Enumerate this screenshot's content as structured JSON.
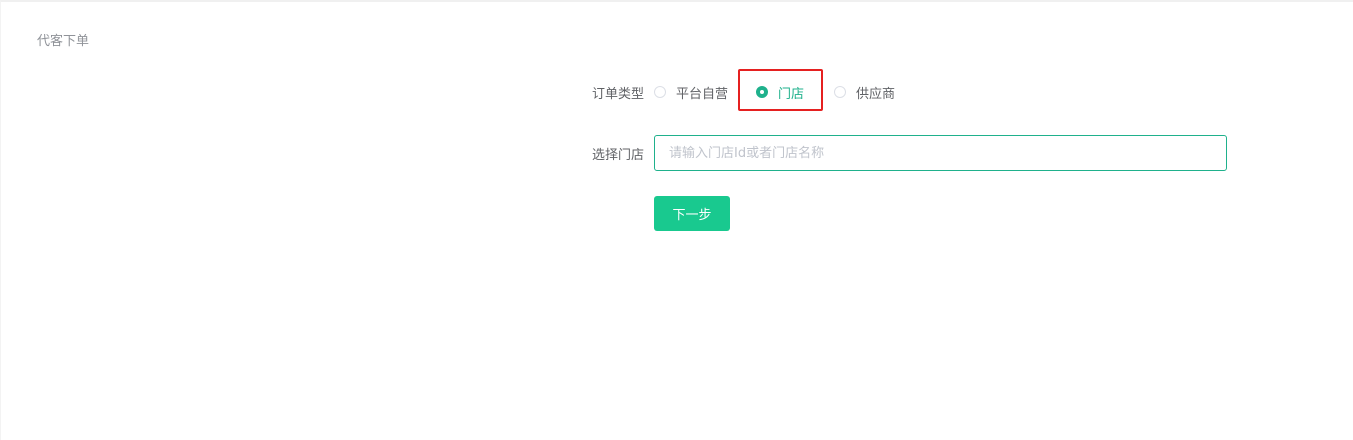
{
  "page": {
    "title": "代客下单"
  },
  "form": {
    "order_type": {
      "label": "订单类型",
      "options": [
        {
          "label": "平台自营",
          "checked": false
        },
        {
          "label": "门店",
          "checked": true
        },
        {
          "label": "供应商",
          "checked": false
        }
      ]
    },
    "store": {
      "label": "选择门店",
      "value": "",
      "placeholder": "请输入门店Id或者门店名称"
    },
    "next_label": "下一步"
  },
  "colors": {
    "accent": "#1fb18c",
    "button": "#19c98f",
    "highlight": "#e52020"
  }
}
